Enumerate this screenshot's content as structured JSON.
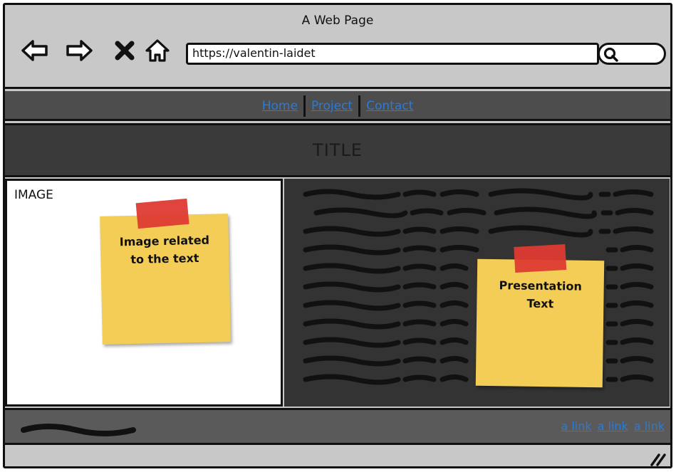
{
  "window": {
    "title": "A Web Page"
  },
  "toolbar": {
    "back_icon": "arrow-left-icon",
    "forward_icon": "arrow-right-icon",
    "stop_icon": "close-icon",
    "home_icon": "home-icon",
    "url": "https://valentin-laidet",
    "search_icon": "search-icon"
  },
  "nav": {
    "items": [
      {
        "label": "Home"
      },
      {
        "label": "Project"
      },
      {
        "label": "Contact"
      }
    ]
  },
  "page": {
    "title": "TITLE",
    "image_label": "IMAGE",
    "image_note": [
      "Image related",
      "to the text"
    ],
    "text_note": [
      "Presentation",
      "Text"
    ]
  },
  "footer": {
    "links": [
      {
        "label": "a link"
      },
      {
        "label": "a link"
      },
      {
        "label": "a link"
      }
    ]
  },
  "colors": {
    "chrome": "#c8c8c8",
    "link": "#2b7bd6",
    "sticky": "#f3cd55",
    "tape": "#dd3b33",
    "dark_panel": "#333333"
  }
}
